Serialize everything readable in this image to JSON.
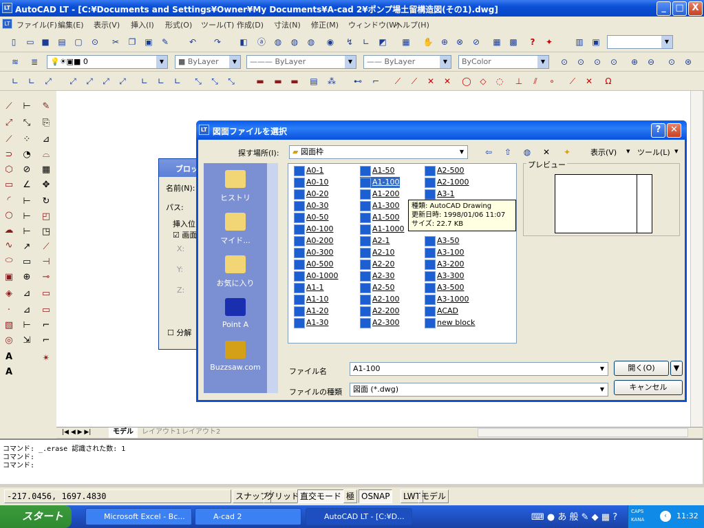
{
  "window": {
    "title": "AutoCAD LT - [C:¥Documents and Settings¥Owner¥My Documents¥A-cad 2¥ポンプ場土留構造図(その1).dwg]",
    "min": "_",
    "max": "□",
    "close": "X"
  },
  "menus": [
    "ファイル(F)",
    "編集(E)",
    "表示(V)",
    "挿入(I)",
    "形式(O)",
    "ツール(T)",
    "作成(D)",
    "寸法(N)",
    "修正(M)",
    "ウィンドウ(W)",
    "ヘルプ(H)"
  ],
  "layerbar": {
    "layer": "0",
    "color": "ByLayer",
    "linetype": "ByLayer",
    "lineweight": "ByLayer",
    "plotstyle": "ByColor"
  },
  "layout_tabs": [
    "モデル",
    "レイアウト1",
    "レイアウト2"
  ],
  "command_lines": [
    "コマンド:  _.erase 認識された数: 1",
    "コマンド:",
    "コマンド:"
  ],
  "status": {
    "coords": "-217.0456, 1697.4830",
    "snap": "スナップ",
    "grid": "グリッド",
    "ortho": "直交モード",
    "polar": "極",
    "osnap": "OSNAP",
    "lwt": "LWT",
    "model": "モデル"
  },
  "taskbar": {
    "start": "スタート",
    "tasks": [
      "Microsoft Excel - Bc...",
      "A-cad 2",
      "AutoCAD LT - [C:¥D..."
    ],
    "time": "11:32",
    "caps": "CAPS",
    "kana": "KANA",
    "ime": "あ 般"
  },
  "back_dialog": {
    "title": "ブロッ",
    "name": "名前(N):",
    "path": "パス:",
    "insert": "挿入位",
    "check": "画面",
    "x": "X:",
    "y": "Y:",
    "z": "Z:",
    "explode": "分解"
  },
  "dialog": {
    "title": "図面ファイルを選択",
    "lookin_label": "探す場所(I):",
    "lookin_value": "図面枠",
    "view": "表示(V)",
    "tools": "ツール(L)",
    "places": [
      "ヒストリ",
      "マイド...",
      "お気に入り",
      "Point A",
      "Buzzsaw.com"
    ],
    "files_col1": [
      "A0-1",
      "A0-10",
      "A0-20",
      "A0-30",
      "A0-50",
      "A0-100",
      "A0-200",
      "A0-300",
      "A0-500",
      "A0-1000",
      "A1-1",
      "A1-10",
      "A1-20",
      "A1-30"
    ],
    "files_col2": [
      "A1-50",
      "A1-100",
      "A1-200",
      "A1-300",
      "A1-500",
      "A1-1000",
      "A2-1",
      "A2-10",
      "A2-20",
      "A2-30",
      "A2-50",
      "A2-100",
      "A2-200",
      "A2-300"
    ],
    "files_col3": [
      "A2-500",
      "A2-1000",
      "A3-1",
      "A3-50",
      "A3-100",
      "A3-200",
      "A3-300",
      "A3-500",
      "A3-1000",
      "ACAD",
      "new block"
    ],
    "tooltip": [
      "種類: AutoCAD Drawing",
      "更新日時: 1998/01/06 11:07",
      "サイズ: 22.7 KB"
    ],
    "preview_label": "プレビュー",
    "filename_label": "ファイル名",
    "filename_value": "A1-100",
    "filetype_label": "ファイルの種類",
    "filetype_value": "図面 (*.dwg)",
    "open": "開く(O)",
    "cancel": "キャンセル"
  }
}
